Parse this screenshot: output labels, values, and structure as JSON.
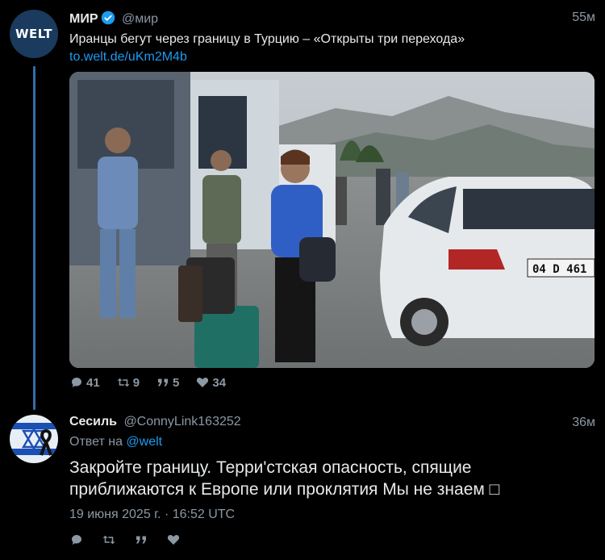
{
  "tweet1": {
    "avatar_text": "WELT",
    "name": "МИР",
    "handle": "@мир",
    "time": "55м",
    "text": "Иранцы бегут через границу в Турцию – «Открыты три перехода»",
    "link": "to.welt.de/uKm2M4b",
    "actions": {
      "replies": "41",
      "retweets": "9",
      "quotes": "5",
      "likes": "34"
    }
  },
  "tweet2": {
    "name": "Сесиль",
    "handle": "@ConnyLink163252",
    "time": "36м",
    "reply_prefix": "Ответ на",
    "reply_to": "@welt",
    "text": "Закройте границу. Терри'стская опасность, спящие приближаются к Европе или проклятия Мы не знаем □",
    "timestamp": "19 июня 2025 г. · 16:52 UTC"
  },
  "photo": {
    "license_plate": "04 D 461"
  },
  "colors": {
    "background": "#000000",
    "link": "#1d9bf0",
    "muted": "#8b98a5",
    "thread": "#2f6fa8"
  }
}
